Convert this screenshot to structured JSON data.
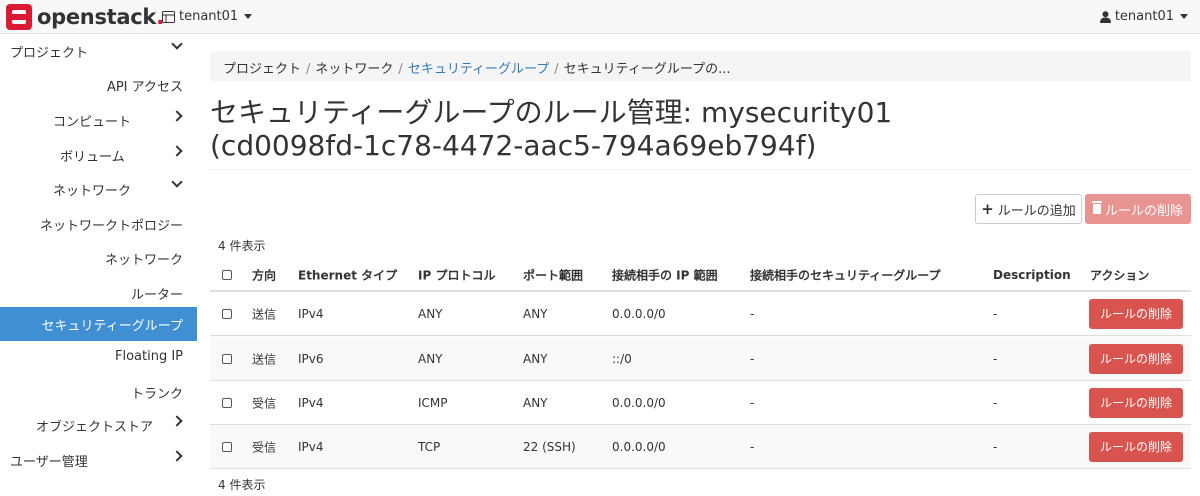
{
  "header": {
    "logo_text": "openstack",
    "logo_dot": ".",
    "project_selector": "tenant01",
    "user_menu": "tenant01"
  },
  "sidebar": {
    "items": [
      {
        "label": "プロジェクト"
      },
      {
        "label": "API アクセス"
      },
      {
        "label": "コンピュート"
      },
      {
        "label": "ボリューム"
      },
      {
        "label": "ネットワーク"
      },
      {
        "label": "ネットワークトポロジー"
      },
      {
        "label": "ネットワーク"
      },
      {
        "label": "ルーター"
      },
      {
        "label": "セキュリティーグループ"
      },
      {
        "label": "Floating IP"
      },
      {
        "label": "トランク"
      },
      {
        "label": "オブジェクトストア"
      },
      {
        "label": "ユーザー管理"
      }
    ]
  },
  "breadcrumb": {
    "items": [
      "プロジェクト",
      "ネットワーク",
      "セキュリティーグループ",
      "セキュリティーグループの..."
    ],
    "separator": "/"
  },
  "page": {
    "title_line1": "セキュリティーグループのルール管理: mysecurity01",
    "title_line2": "(cd0098fd-1c78-4472-aac5-794a69eb794f)"
  },
  "actions": {
    "add_rule": "ルールの追加",
    "delete_rules": "ルールの削除"
  },
  "table": {
    "count_top": "4 件表示",
    "count_bottom": "4 件表示",
    "columns": [
      "方向",
      "Ethernet タイプ",
      "IP プロトコル",
      "ポート範囲",
      "接続相手の IP 範囲",
      "接続相手のセキュリティーグループ",
      "Description",
      "アクション"
    ],
    "rows": [
      {
        "direction": "送信",
        "ethertype": "IPv4",
        "protocol": "ANY",
        "port": "ANY",
        "remote_ip": "0.0.0.0/0",
        "remote_sg": "-",
        "description": "-",
        "action": "ルールの削除"
      },
      {
        "direction": "送信",
        "ethertype": "IPv6",
        "protocol": "ANY",
        "port": "ANY",
        "remote_ip": "::/0",
        "remote_sg": "-",
        "description": "-",
        "action": "ルールの削除"
      },
      {
        "direction": "受信",
        "ethertype": "IPv4",
        "protocol": "ICMP",
        "port": "ANY",
        "remote_ip": "0.0.0.0/0",
        "remote_sg": "-",
        "description": "-",
        "action": "ルールの削除"
      },
      {
        "direction": "受信",
        "ethertype": "IPv4",
        "protocol": "TCP",
        "port": "22 (SSH)",
        "remote_ip": "0.0.0.0/0",
        "remote_sg": "-",
        "description": "-",
        "action": "ルールの削除"
      }
    ]
  },
  "colors": {
    "accent": "#3f8fd2",
    "danger": "#d9534f",
    "danger_disabled": "#e89491",
    "brand": "#da1a32"
  }
}
